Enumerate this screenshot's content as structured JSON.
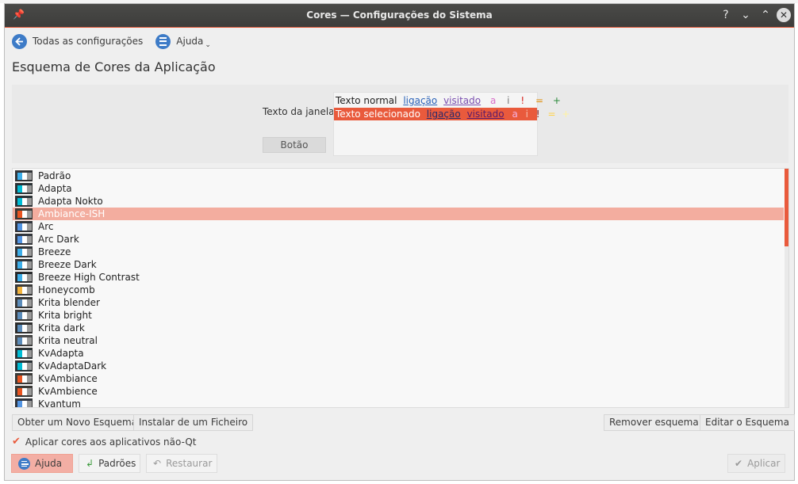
{
  "window": {
    "title": "Cores — Configurações do Sistema",
    "help_glyph": "?",
    "minimize_glyph": "⌄",
    "maximize_glyph": "⌃",
    "close_glyph": "✕"
  },
  "nav": {
    "back_label": "Todas as configurações",
    "help_label": "Ajuda"
  },
  "page_title": "Esquema de Cores da Aplicação",
  "preview": {
    "window_text_label": "Texto da janela",
    "button_label": "Botão",
    "normal": {
      "text": "Texto normal",
      "link": "ligação",
      "visited": "visitado",
      "a": "a",
      "i": "i",
      "excl": "!",
      "eq": "=",
      "plus": "+"
    },
    "selected": {
      "text": "Texto selecionado",
      "link": "ligação",
      "visited": "visitado",
      "a": "a",
      "i": "i",
      "excl": "!",
      "eq": "=",
      "plus": "+"
    }
  },
  "schemes": [
    {
      "label": "Padrão",
      "colors": [
        "#3daee9",
        "#ffffff",
        "#31363b"
      ]
    },
    {
      "label": "Adapta",
      "colors": [
        "#00bcd4",
        "#ffffff",
        "#263238"
      ]
    },
    {
      "label": "Adapta Nokto",
      "colors": [
        "#00bcd4",
        "#ffffff",
        "#263238"
      ]
    },
    {
      "label": "Ambiance-ISH",
      "colors": [
        "#e95420",
        "#ffffff",
        "#3c3b37"
      ]
    },
    {
      "label": "Arc",
      "colors": [
        "#5294e2",
        "#ffffff",
        "#2f343f"
      ]
    },
    {
      "label": "Arc Dark",
      "colors": [
        "#5294e2",
        "#ffffff",
        "#2f343f"
      ]
    },
    {
      "label": "Breeze",
      "colors": [
        "#3daee9",
        "#ffffff",
        "#31363b"
      ]
    },
    {
      "label": "Breeze Dark",
      "colors": [
        "#3daee9",
        "#ffffff",
        "#31363b"
      ]
    },
    {
      "label": "Breeze High Contrast",
      "colors": [
        "#3daee9",
        "#ffffff",
        "#232629"
      ]
    },
    {
      "label": "Honeycomb",
      "colors": [
        "#f2b33d",
        "#ffffff",
        "#3c3c3c"
      ]
    },
    {
      "label": "Krita blender",
      "colors": [
        "#5b8cba",
        "#ffffff",
        "#3a3a3a"
      ]
    },
    {
      "label": "Krita bright",
      "colors": [
        "#5b8cba",
        "#ffffff",
        "#3a3a3a"
      ]
    },
    {
      "label": "Krita dark",
      "colors": [
        "#5b8cba",
        "#ffffff",
        "#2a2a2a"
      ]
    },
    {
      "label": "Krita neutral",
      "colors": [
        "#5b8cba",
        "#ffffff",
        "#4a4a4a"
      ]
    },
    {
      "label": "KvAdapta",
      "colors": [
        "#00bcd4",
        "#ffffff",
        "#263238"
      ]
    },
    {
      "label": "KvAdaptaDark",
      "colors": [
        "#00bcd4",
        "#ffffff",
        "#263238"
      ]
    },
    {
      "label": "KvAmbiance",
      "colors": [
        "#e95420",
        "#ffffff",
        "#3c3b37"
      ]
    },
    {
      "label": "KvAmbience",
      "colors": [
        "#e95420",
        "#ffffff",
        "#3c3b37"
      ]
    },
    {
      "label": "Kvantum",
      "colors": [
        "#5294e2",
        "#ffffff",
        "#2f343f"
      ]
    }
  ],
  "selected_scheme": "Ambiance-ISH",
  "actions": {
    "new_scheme": "Obter um Novo Esquema",
    "install_file": "Instalar de um Ficheiro",
    "remove_scheme": "Remover esquema",
    "edit_scheme": "Editar o Esquema"
  },
  "apply_non_qt": {
    "label": "Aplicar cores aos aplicativos não-Qt",
    "checked": true,
    "check_glyph": "✔"
  },
  "footer": {
    "help": "Ajuda",
    "defaults": "Padrões",
    "restore": "Restaurar",
    "apply": "Aplicar"
  },
  "colors": {
    "accent": "#e95a3c",
    "selection_row": "#f3ad9f",
    "link": "#2a62b8",
    "visited": "#7a4fb0"
  }
}
